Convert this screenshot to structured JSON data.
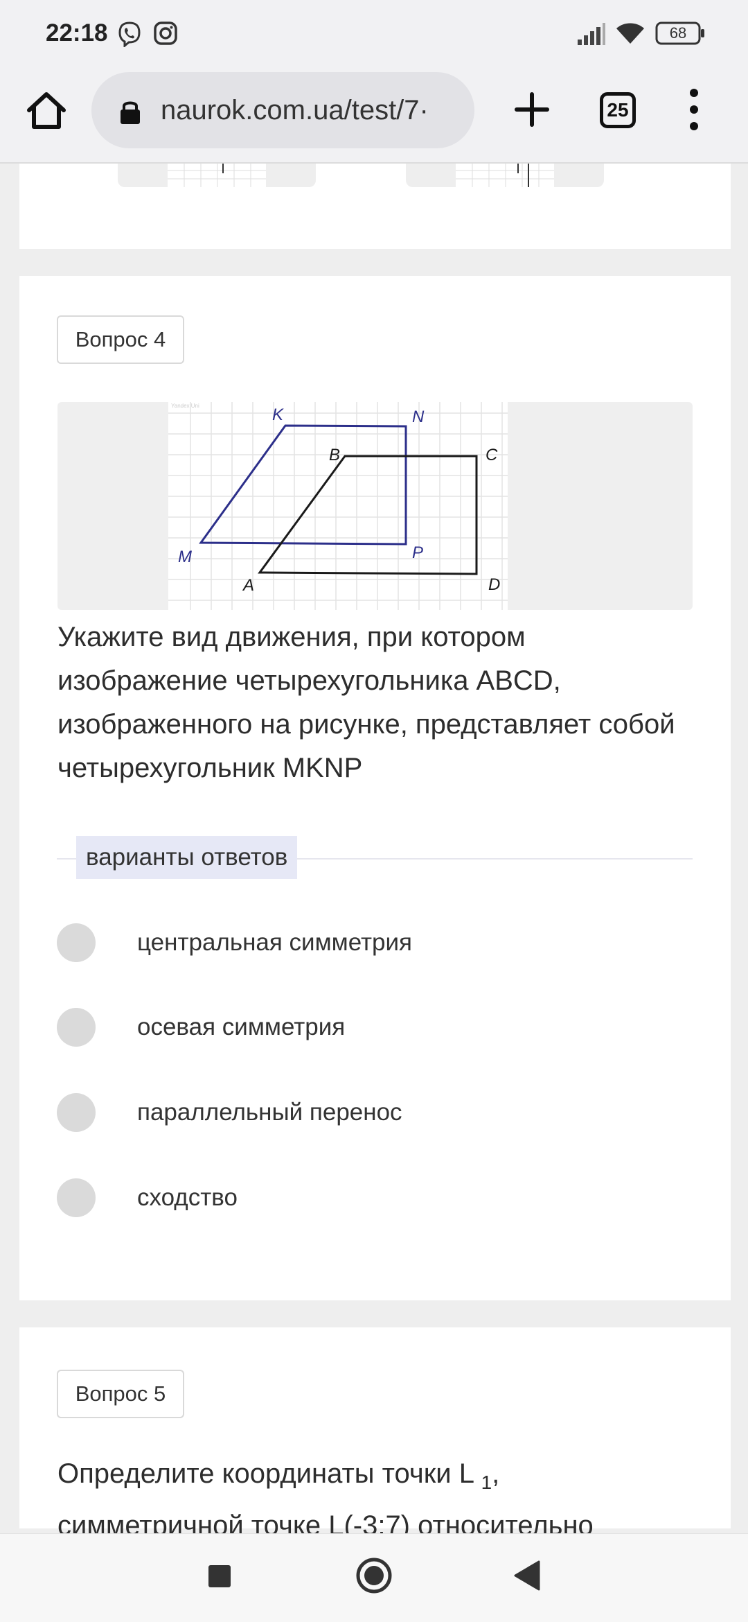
{
  "status_bar": {
    "time": "22:18",
    "icons": [
      "viber-icon",
      "instagram-icon",
      "signal-icon",
      "wifi-icon",
      "battery-icon"
    ],
    "battery": "68"
  },
  "browser": {
    "url": "naurok.com.ua/test/7·",
    "tab_count": "25",
    "icons": [
      "home-icon",
      "lock-icon",
      "plus-icon",
      "tabs-icon",
      "more-vert-icon"
    ]
  },
  "question4": {
    "badge": "Вопрос 4",
    "figure": {
      "watermark": "Yandex Uni",
      "labels": {
        "K": "K",
        "N": "N",
        "M": "M",
        "P": "P",
        "B": "B",
        "C": "C",
        "A": "A",
        "D": "D"
      },
      "colors": {
        "mknp": "#2c2f8a",
        "abcd": "#1a1a1a"
      }
    },
    "text": "Укажите вид движения, при котором изображение четырехугольника ABCD, изображенного на рисунке, представляет собой четырехугольник MKNP",
    "answers_label": "варианты ответов",
    "options": [
      {
        "label": "центральная симметрия"
      },
      {
        "label": "осевая симметрия"
      },
      {
        "label": "параллельный перенос"
      },
      {
        "label": "сходство"
      }
    ]
  },
  "question5": {
    "badge": "Вопрос 5",
    "text_line1": "Определите координаты точки L",
    "subscript": "1",
    "text_line1_end": ",",
    "text_line2": "симметричной точке L(-3;7) относительно"
  },
  "nav_bar": {
    "icons": [
      "recents-square-icon",
      "home-circle-icon",
      "back-triangle-icon"
    ]
  },
  "colors": {
    "accent_label_bg": "#e6e8f6",
    "radio": "#dadada",
    "page_bg": "#eeeeee"
  }
}
